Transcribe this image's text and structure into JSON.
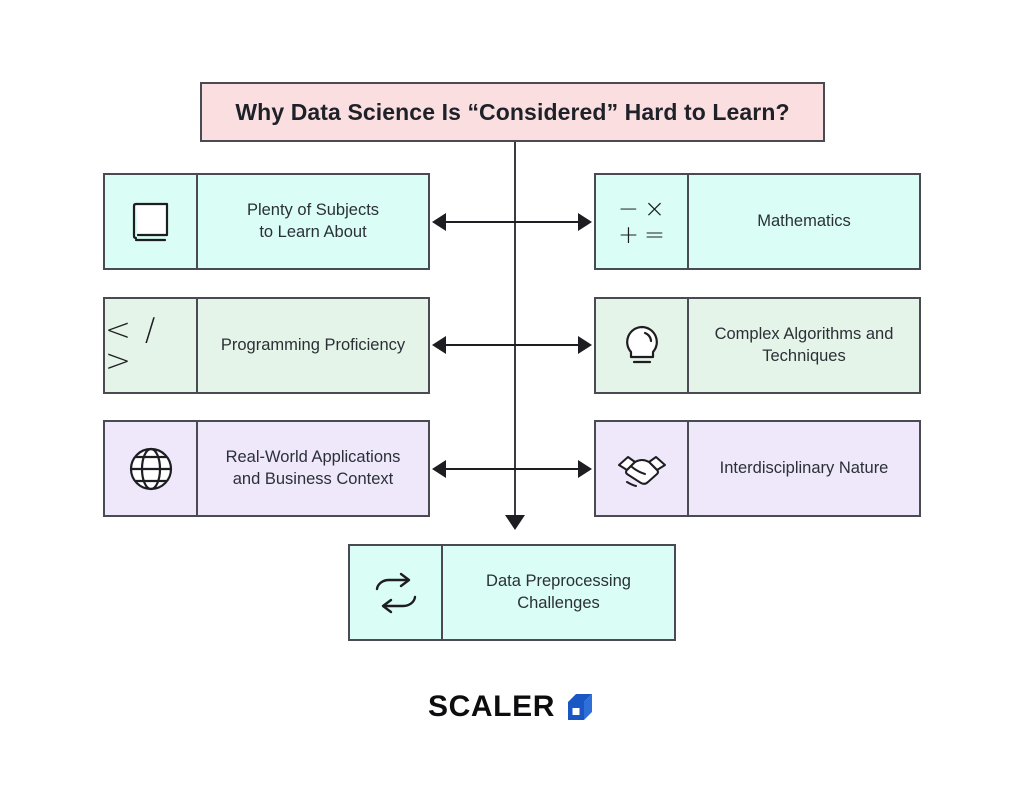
{
  "title": {
    "text": "Why Data Science Is “Considered” Hard to Learn?",
    "background": "#fadee0",
    "border": "#4a4a52"
  },
  "rows": [
    {
      "tint": "#dafdf5",
      "left": {
        "icon": "book-icon",
        "label": "Plenty of Subjects\nto Learn About"
      },
      "right": {
        "icon": "math-symbols-icon",
        "label": "Mathematics"
      }
    },
    {
      "tint": "#e4f4e8",
      "left": {
        "icon": "code-brackets-icon",
        "label": "Programming Proficiency"
      },
      "right": {
        "icon": "lightbulb-icon",
        "label": "Complex Algorithms and\nTechniques"
      }
    },
    {
      "tint": "#efe7fa",
      "left": {
        "icon": "globe-icon",
        "label": "Real-World Applications\nand Business Context"
      },
      "right": {
        "icon": "handshake-icon",
        "label": "Interdisciplinary Nature"
      }
    }
  ],
  "bottom": {
    "tint": "#dafdf5",
    "icon": "sync-arrows-icon",
    "label": "Data Preprocessing\nChallenges"
  },
  "cards": {
    "r1_left_line1": "Plenty of Subjects",
    "r1_left_line2": "to Learn About",
    "r1_right": "Mathematics",
    "r2_left": "Programming Proficiency",
    "r2_right_line1": "Complex Algorithms and",
    "r2_right_line2": "Techniques",
    "r3_left_line1": "Real-World Applications",
    "r3_left_line2": "and Business Context",
    "r3_right": "Interdisciplinary Nature",
    "bottom_line1": "Data Preprocessing",
    "bottom_line2": "Challenges"
  },
  "math_symbols": {
    "minus": "−",
    "times": "×",
    "plus": "+",
    "equals": "="
  },
  "code_icon": {
    "glyphs": "< / >"
  },
  "logo": {
    "text": "SCALER",
    "mark": "cube-logo-mark",
    "mark_color": "#1a56c4"
  },
  "colors": {
    "text": "#2b3038",
    "stroke": "#4a4a52",
    "arrow": "#1d1d22",
    "page_background": "#ffffff"
  }
}
